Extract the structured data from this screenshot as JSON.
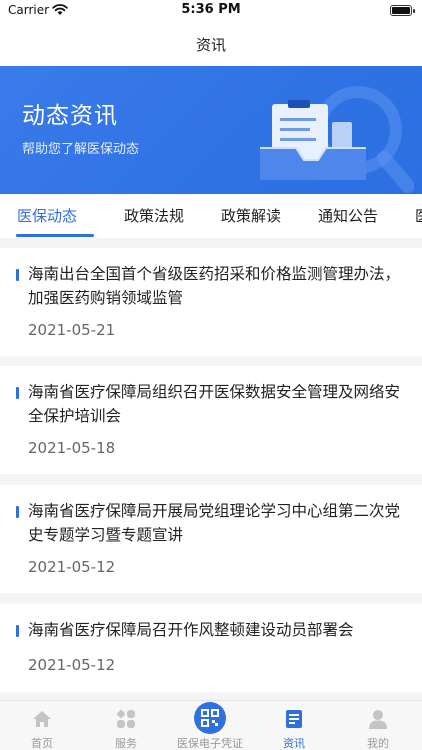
{
  "status_bar": {
    "carrier": "Carrier",
    "time": "5:36 PM"
  },
  "nav": {
    "title": "资讯"
  },
  "banner": {
    "title": "动态资讯",
    "subtitle": "帮助您了解医保动态"
  },
  "tabs": [
    {
      "label": "医保动态",
      "active": true
    },
    {
      "label": "政策法规",
      "active": false
    },
    {
      "label": "政策解读",
      "active": false
    },
    {
      "label": "通知公告",
      "active": false
    },
    {
      "label": "医",
      "active": false
    }
  ],
  "news": [
    {
      "title": "海南出台全国首个省级医药招采和价格监测管理办法，加强医药购销领域监管",
      "date": "2021-05-21"
    },
    {
      "title": "海南省医疗保障局组织召开医保数据安全管理及网络安全保护培训会",
      "date": "2021-05-18"
    },
    {
      "title": "海南省医疗保障局开展局党组理论学习中心组第二次党史专题学习暨专题宣讲",
      "date": "2021-05-12"
    },
    {
      "title": "海南省医疗保障局召开作风整顿建设动员部署会",
      "date": "2021-05-12"
    }
  ],
  "tabbar": [
    {
      "label": "首页",
      "icon": "home-icon",
      "active": false
    },
    {
      "label": "服务",
      "icon": "services-icon",
      "active": false
    },
    {
      "label": "医保电子凭证",
      "icon": "qr-code-icon",
      "active": false
    },
    {
      "label": "资讯",
      "icon": "news-icon",
      "active": true
    },
    {
      "label": "我的",
      "icon": "profile-icon",
      "active": false
    }
  ],
  "colors": {
    "accent": "#2e6fe2",
    "banner": "#3a7bea",
    "background": "#f3f4f6"
  }
}
